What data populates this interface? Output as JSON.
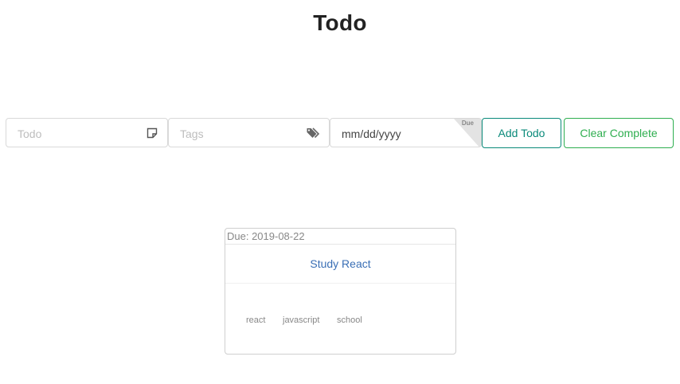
{
  "header": {
    "title": "Todo"
  },
  "form": {
    "todo_placeholder": "Todo",
    "tags_placeholder": "Tags",
    "date_value": "mm/dd/yyyy",
    "date_corner_label": "Due",
    "add_label": "Add Todo",
    "clear_label": "Clear Complete"
  },
  "icons": {
    "todo_icon": "note-icon",
    "tags_icon": "tags-icon"
  },
  "colors": {
    "add_button": "#0a8a7a",
    "clear_button": "#2eae4f",
    "todo_link": "#3a6fb5"
  },
  "todos": [
    {
      "due": "Due: 2019-08-22",
      "title": "Study React",
      "tags": [
        "react",
        "javascript",
        "school"
      ]
    }
  ]
}
